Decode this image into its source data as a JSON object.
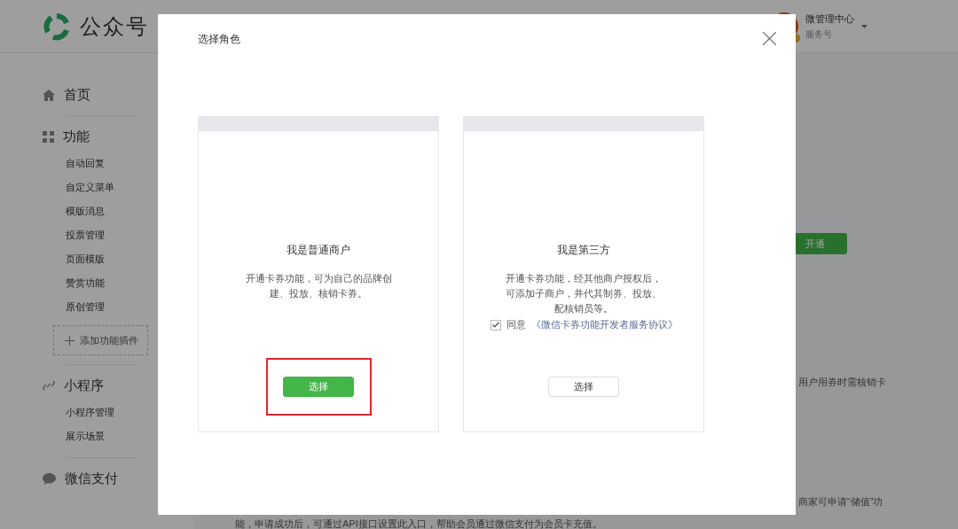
{
  "header": {
    "logo_text": "公众号",
    "account": {
      "name": "微管理中心",
      "type": "服务号"
    }
  },
  "sidebar": {
    "sections": [
      {
        "label": "首页"
      },
      {
        "label": "功能",
        "items": [
          "自动回复",
          "自定义菜单",
          "模版消息",
          "投票管理",
          "页面模版",
          "赞赏功能",
          "原创管理"
        ],
        "add_plugin": "添加功能插件"
      },
      {
        "label": "小程序",
        "items": [
          "小程序管理",
          "展示场景"
        ]
      },
      {
        "label": "微信支付"
      }
    ]
  },
  "main": {
    "open_button": "开通",
    "text_1": "用户用券时需核销卡",
    "text_2": "商家可申请“储值”功",
    "text_3": "能，申请成功后，可通过API接口设置此入口，帮助会员通过微信支付为会员卡充值。"
  },
  "modal": {
    "title": "选择角色",
    "cards": [
      {
        "title": "我是普通商户",
        "description": [
          "开通卡券功能，可为自己的品牌创",
          "建、投放、核销卡券。"
        ],
        "button": {
          "label": "选择",
          "primary": true
        },
        "highlighted": true
      },
      {
        "title": "我是第三方",
        "description": [
          "开通卡券功能，经其他商户授权后，",
          "可添加子商户，并代其制券、投放、",
          "配核销员等。"
        ],
        "agreement": {
          "checked": true,
          "prefix": "同意",
          "link": "《微信卡券功能开发者服务协议》"
        },
        "button": {
          "label": "选择",
          "primary": false
        },
        "highlighted": false
      }
    ]
  }
}
